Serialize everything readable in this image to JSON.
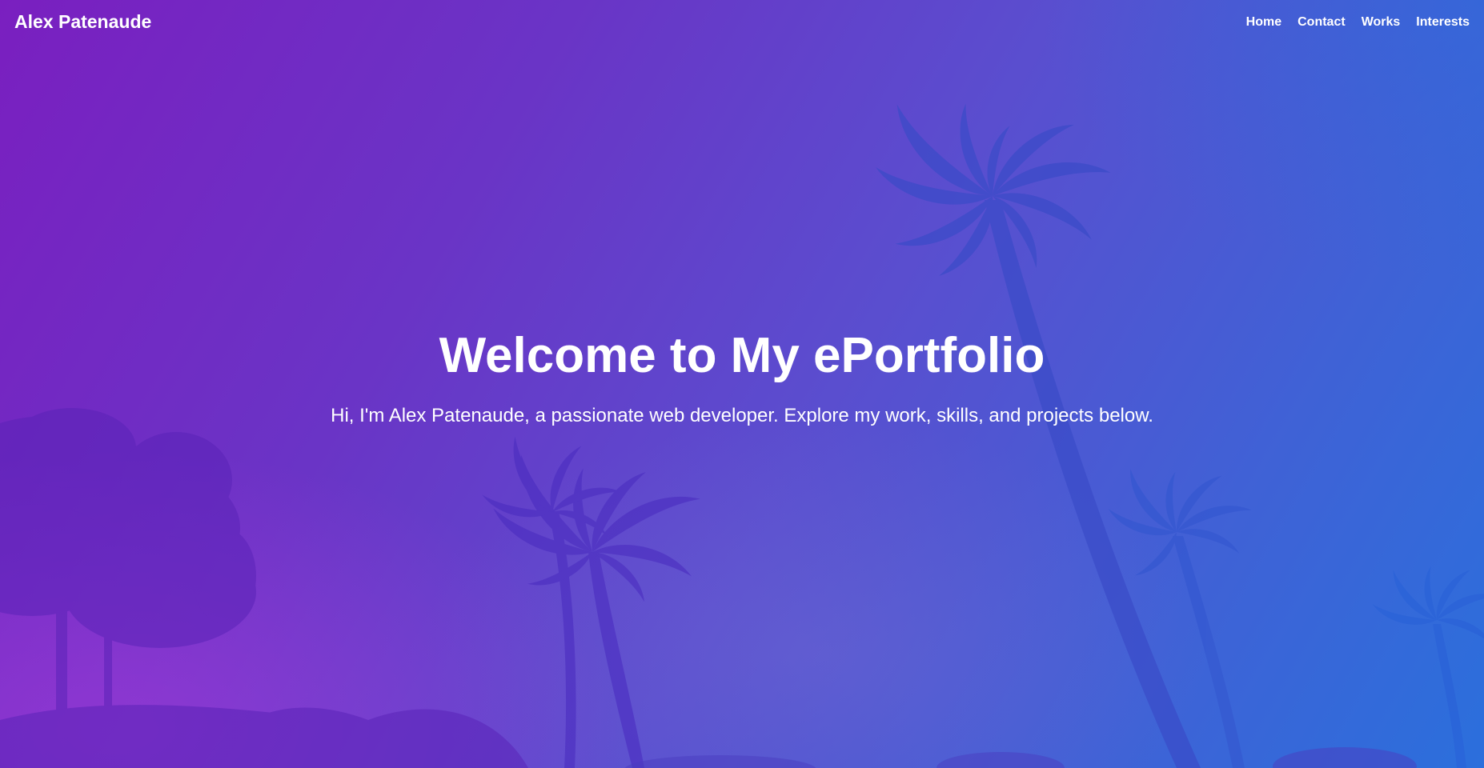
{
  "navbar": {
    "brand": "Alex Patenaude",
    "links": [
      {
        "label": "Home"
      },
      {
        "label": "Contact"
      },
      {
        "label": "Works"
      },
      {
        "label": "Interests"
      }
    ]
  },
  "hero": {
    "title": "Welcome to My ePortfolio",
    "subtitle": "Hi, I'm Alex Patenaude, a passionate web developer. Explore my work, skills, and projects below."
  },
  "colors": {
    "gradient_start": "#7a1fc0",
    "gradient_mid": "#5a4ecf",
    "gradient_end": "#2b6fdc",
    "text": "#ffffff"
  }
}
